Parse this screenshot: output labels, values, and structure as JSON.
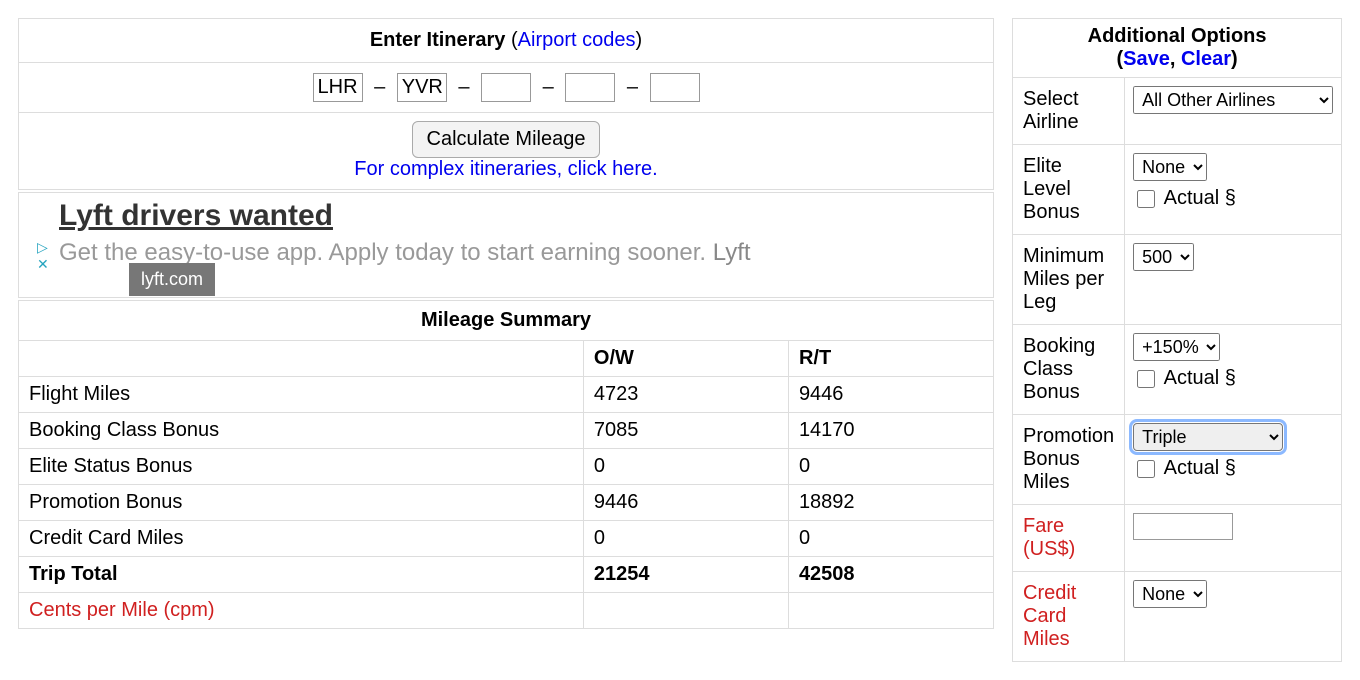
{
  "itinerary": {
    "title_prefix": "Enter Itinerary",
    "airport_codes_label": "Airport codes",
    "separator": "–",
    "segments": [
      "LHR",
      "YVR",
      "",
      "",
      ""
    ],
    "calculate_button": "Calculate Mileage",
    "complex_link": "For complex itineraries, click here."
  },
  "ad": {
    "title": "Lyft drivers wanted",
    "body": "Get the easy-to-use app. Apply today to start earning sooner.",
    "brand": "Lyft",
    "tooltip": "lyft.com",
    "info_glyph": "▷",
    "close_glyph": "✕"
  },
  "summary": {
    "title": "Mileage Summary",
    "col1": "O/W",
    "col2": "R/T",
    "rows": [
      {
        "label": "Flight Miles",
        "ow": "4723",
        "rt": "9446",
        "bold": false,
        "red": false
      },
      {
        "label": "Booking Class Bonus",
        "ow": "7085",
        "rt": "14170",
        "bold": false,
        "red": false
      },
      {
        "label": "Elite Status Bonus",
        "ow": "0",
        "rt": "0",
        "bold": false,
        "red": false
      },
      {
        "label": "Promotion Bonus",
        "ow": "9446",
        "rt": "18892",
        "bold": false,
        "red": false
      },
      {
        "label": "Credit Card Miles",
        "ow": "0",
        "rt": "0",
        "bold": false,
        "red": false
      },
      {
        "label": "Trip Total",
        "ow": "21254",
        "rt": "42508",
        "bold": true,
        "red": false
      },
      {
        "label": "Cents per Mile (cpm)",
        "ow": "",
        "rt": "",
        "bold": false,
        "red": true
      }
    ]
  },
  "options": {
    "title": "Additional Options",
    "save_label": "Save",
    "clear_label": "Clear",
    "comma": ", ",
    "actual_label": "Actual §",
    "rows": {
      "airline": {
        "label": "Select Airline",
        "value": "All Other Airlines"
      },
      "elite": {
        "label": "Elite Level Bonus",
        "value": "None"
      },
      "minmiles": {
        "label": "Minimum Miles per Leg",
        "value": "500"
      },
      "booking": {
        "label": "Booking Class Bonus",
        "value": "+150%"
      },
      "promo": {
        "label": "Promotion Bonus Miles",
        "value": "Triple"
      },
      "fare": {
        "label": "Fare (US$)",
        "value": ""
      },
      "cc": {
        "label": "Credit Card Miles",
        "value": "None"
      }
    }
  }
}
